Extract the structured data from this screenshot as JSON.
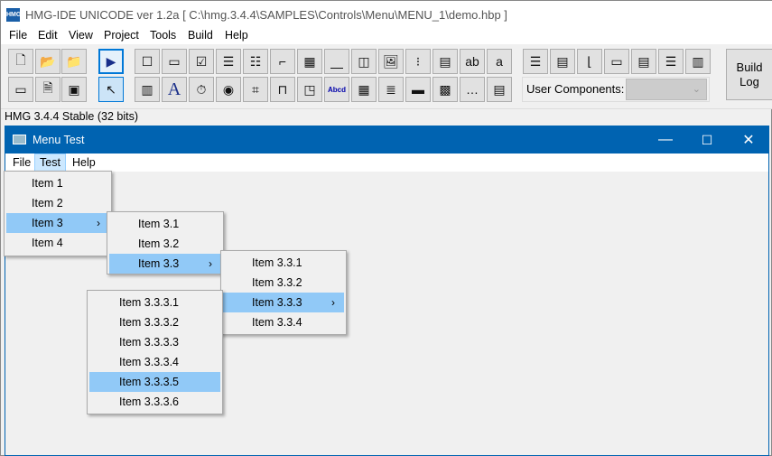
{
  "app": {
    "title": "HMG-IDE  UNICODE  ver 1.2a  [ C:\\hmg.3.4.4\\SAMPLES\\Controls\\Menu\\MENU_1\\demo.hbp ]",
    "icon_text": "HMG"
  },
  "menu": [
    "File",
    "Edit",
    "View",
    "Project",
    "Tools",
    "Build",
    "Help"
  ],
  "toolbar": {
    "row1": [
      [
        "new-file",
        "🗋"
      ],
      [
        "open-folder",
        "📂"
      ],
      [
        "open-project",
        "📁"
      ],
      [
        "run",
        "▶"
      ],
      [
        "button",
        "☐"
      ],
      [
        "rounded-button",
        "▭"
      ],
      [
        "checkbox",
        "☑"
      ],
      [
        "listbox",
        "☰"
      ],
      [
        "combobox",
        "☷"
      ],
      [
        "line",
        "⌐"
      ],
      [
        "grid",
        "▦"
      ],
      [
        "slider",
        "⎽"
      ],
      [
        "spinner",
        "◫"
      ],
      [
        "image",
        "🖼"
      ],
      [
        "tree",
        "⁝"
      ],
      [
        "datepicker",
        "▤"
      ],
      [
        "textbox",
        "ab"
      ],
      [
        "edit-box",
        "a"
      ]
    ],
    "row2": [
      [
        "form",
        "▭"
      ],
      [
        "document",
        "🗎"
      ],
      [
        "film",
        "▣"
      ],
      [
        "pointer",
        "↖"
      ],
      [
        "books",
        "▥"
      ],
      [
        "label",
        "A"
      ],
      [
        "timer",
        "⏱"
      ],
      [
        "radio",
        "◉"
      ],
      [
        "frame",
        "⌗"
      ],
      [
        "tab",
        "⊓"
      ],
      [
        "progress",
        "◳"
      ],
      [
        "hyperlink",
        "Abcd"
      ],
      [
        "monthcal",
        "▦"
      ],
      [
        "richedit",
        "≣"
      ],
      [
        "progressbar",
        "▬"
      ],
      [
        "activex",
        "▩"
      ],
      [
        "ipaddress",
        "…"
      ],
      [
        "browse",
        "▤"
      ]
    ],
    "row_right": [
      [
        "toolbar-a",
        "☰"
      ],
      [
        "toolbar-b",
        "▤"
      ],
      [
        "statusbar",
        "⌊"
      ],
      [
        "panel",
        "▭"
      ],
      [
        "toolbar-c",
        "▤"
      ],
      [
        "toolbar-d",
        "☰"
      ],
      [
        "grid-b",
        "▥"
      ]
    ],
    "user_components_label": "User Components:",
    "user_components_value": "",
    "build_log": [
      "Build",
      "Log"
    ]
  },
  "status": "HMG 3.4.4 Stable (32 bits)",
  "child": {
    "title": "Menu Test",
    "controls": {
      "minimize": "—",
      "maximize": "☐",
      "close": "✕"
    },
    "menu": [
      "File",
      "Test",
      "Help"
    ],
    "active_menu": "Test",
    "menu1": [
      "Item 1",
      "Item 2",
      "Item 3",
      "Item 4"
    ],
    "menu2": [
      "Item 3.1",
      "Item 3.2",
      "Item 3.3"
    ],
    "menu3": [
      "Item 3.3.1",
      "Item 3.3.2",
      "Item 3.3.3",
      "Item 3.3.4"
    ],
    "menu4": [
      "Item 3.3.3.1",
      "Item 3.3.3.2",
      "Item 3.3.3.3",
      "Item 3.3.3.4",
      "Item 3.3.3.5",
      "Item 3.3.3.6"
    ],
    "submenu_arrow": "›",
    "highlight_color": "#91c9f7",
    "titlebar_color": "#0063b1"
  }
}
